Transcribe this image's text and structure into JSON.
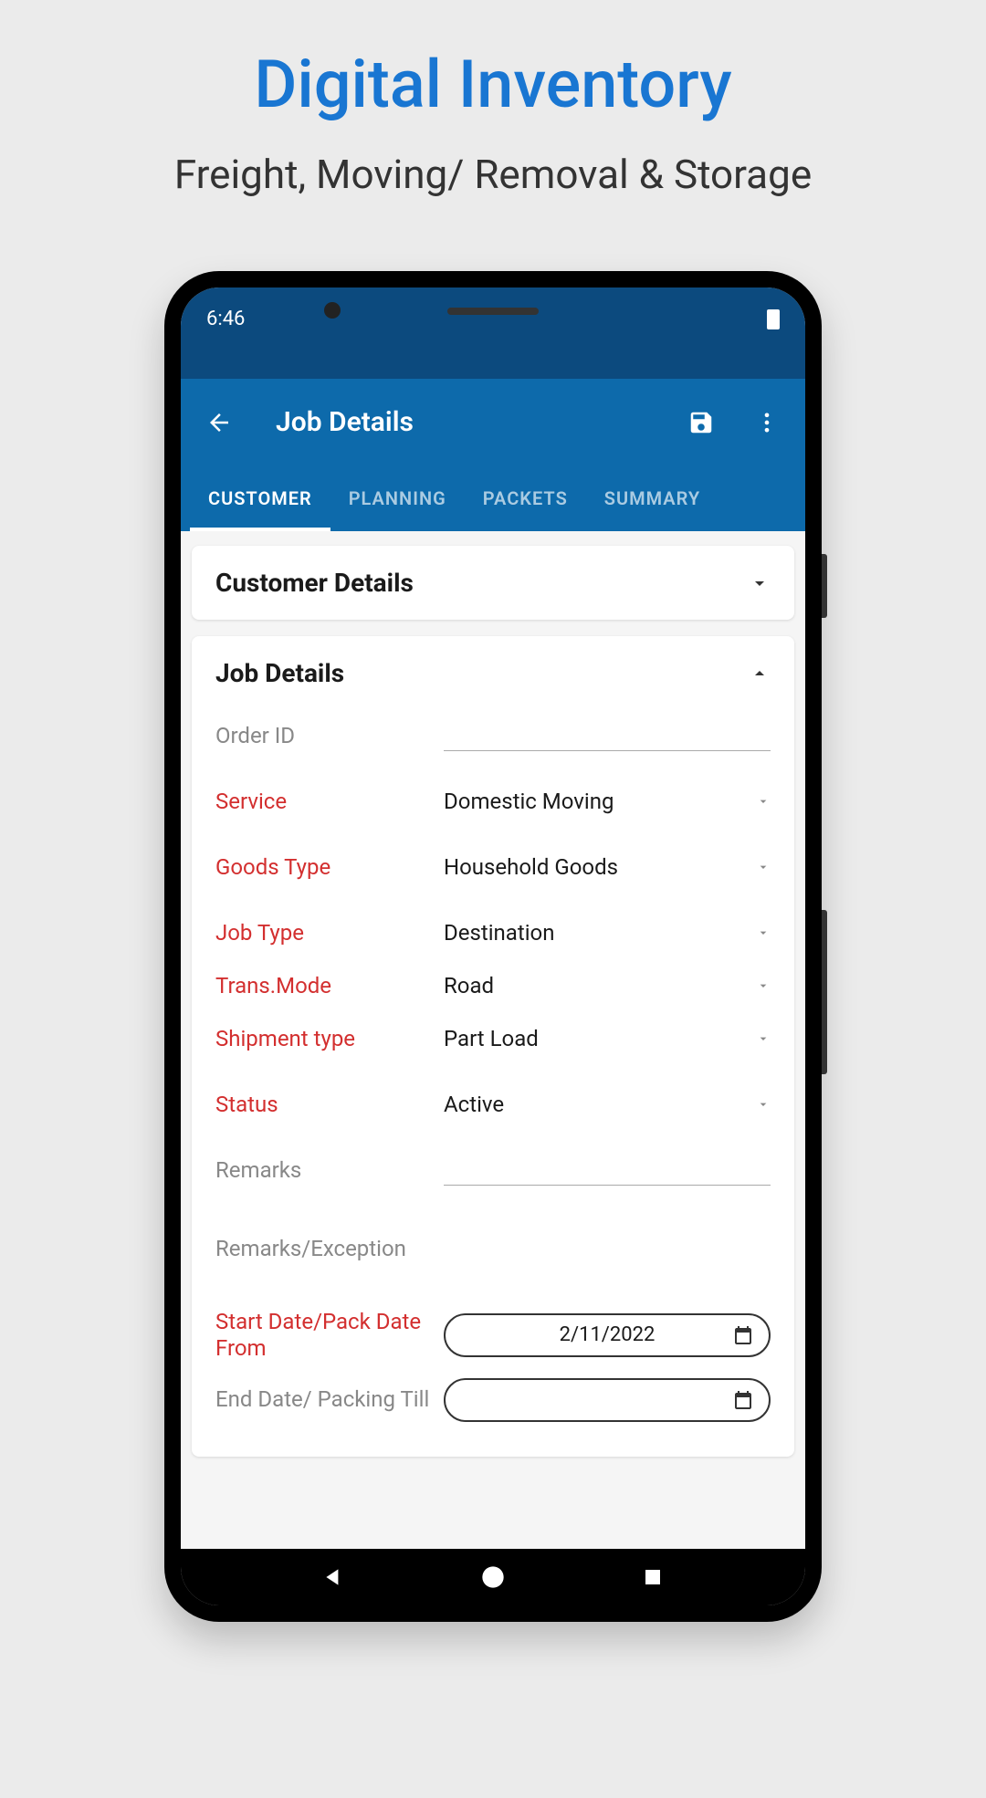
{
  "page": {
    "title": "Digital Inventory",
    "subtitle": "Freight, Moving/ Removal & Storage"
  },
  "statusBar": {
    "time": "6:46"
  },
  "appBar": {
    "title": "Job Details"
  },
  "tabs": {
    "items": [
      "CUSTOMER",
      "PLANNING",
      "PACKETS",
      "SUMMARY"
    ],
    "active": 0
  },
  "cards": {
    "customerDetails": {
      "title": "Customer Details"
    },
    "jobDetails": {
      "title": "Job Details",
      "fields": {
        "orderId": {
          "label": "Order ID",
          "value": ""
        },
        "service": {
          "label": "Service",
          "value": "Domestic Moving"
        },
        "goodsType": {
          "label": "Goods Type",
          "value": "Household Goods"
        },
        "jobType": {
          "label": "Job Type",
          "value": "Destination"
        },
        "transMode": {
          "label": "Trans.Mode",
          "value": "Road"
        },
        "shipmentType": {
          "label": "Shipment type",
          "value": "Part Load"
        },
        "status": {
          "label": "Status",
          "value": "Active"
        },
        "remarks": {
          "label": "Remarks",
          "value": ""
        },
        "remarksException": {
          "label": "Remarks/Exception",
          "value": ""
        },
        "startDate": {
          "label": "Start Date/Pack Date From",
          "value": "2/11/2022"
        },
        "endDate": {
          "label": "End Date/ Packing Till",
          "value": ""
        }
      }
    }
  }
}
